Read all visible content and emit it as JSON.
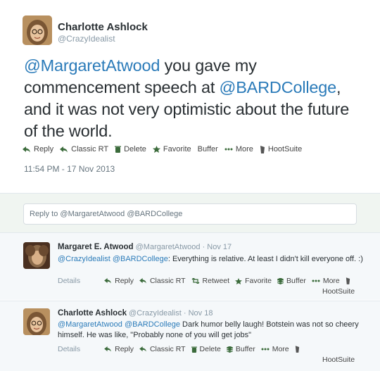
{
  "main_tweet": {
    "author_name": "Charlotte Ashlock",
    "author_handle": "@CrazyIdealist",
    "text_mention_1": "@MargaretAtwood",
    "text_part_1": " you gave my commencement speech at ",
    "text_mention_2": "@BARDCollege",
    "text_part_2": ", and it was not very optimistic about the future of the world.",
    "actions": {
      "reply": "Reply",
      "classic_rt": "Classic RT",
      "delete": "Delete",
      "favorite": "Favorite",
      "buffer": "Buffer",
      "more": "More",
      "hootsuite": "HootSuite"
    },
    "timestamp": "11:54 PM - 17 Nov 2013"
  },
  "reply_box": {
    "placeholder": "Reply to @MargaretAtwood @BARDCollege"
  },
  "replies": [
    {
      "author_name": "Margaret E. Atwood",
      "author_handle": "@MargaretAtwood",
      "date": "· Nov 17",
      "mention_1": "@CrazyIdealist",
      "mention_2": "@BARDCollege",
      "text": ": Everything is relative. At least I didn't kill everyone off. :)",
      "actions": {
        "details": "Details",
        "reply": "Reply",
        "classic_rt": "Classic RT",
        "retweet": "Retweet",
        "favorite": "Favorite",
        "buffer": "Buffer",
        "more": "More",
        "hootsuite": "HootSuite"
      }
    },
    {
      "author_name": "Charlotte Ashlock",
      "author_handle": "@CrazyIdealist",
      "date": "· Nov 18",
      "mention_1": "@MargaretAtwood",
      "mention_2": "@BARDCollege",
      "text": " Dark humor belly laugh! Botstein was not so cheery himself. He was like, \"Probably none of you will get jobs\"",
      "actions": {
        "details": "Details",
        "reply": "Reply",
        "classic_rt": "Classic RT",
        "delete": "Delete",
        "buffer": "Buffer",
        "more": "More",
        "hootsuite": "HootSuite"
      }
    }
  ],
  "colors": {
    "link": "#2b7bb9",
    "muted": "#8899a6",
    "reply_bg": "#f0f5f1"
  }
}
